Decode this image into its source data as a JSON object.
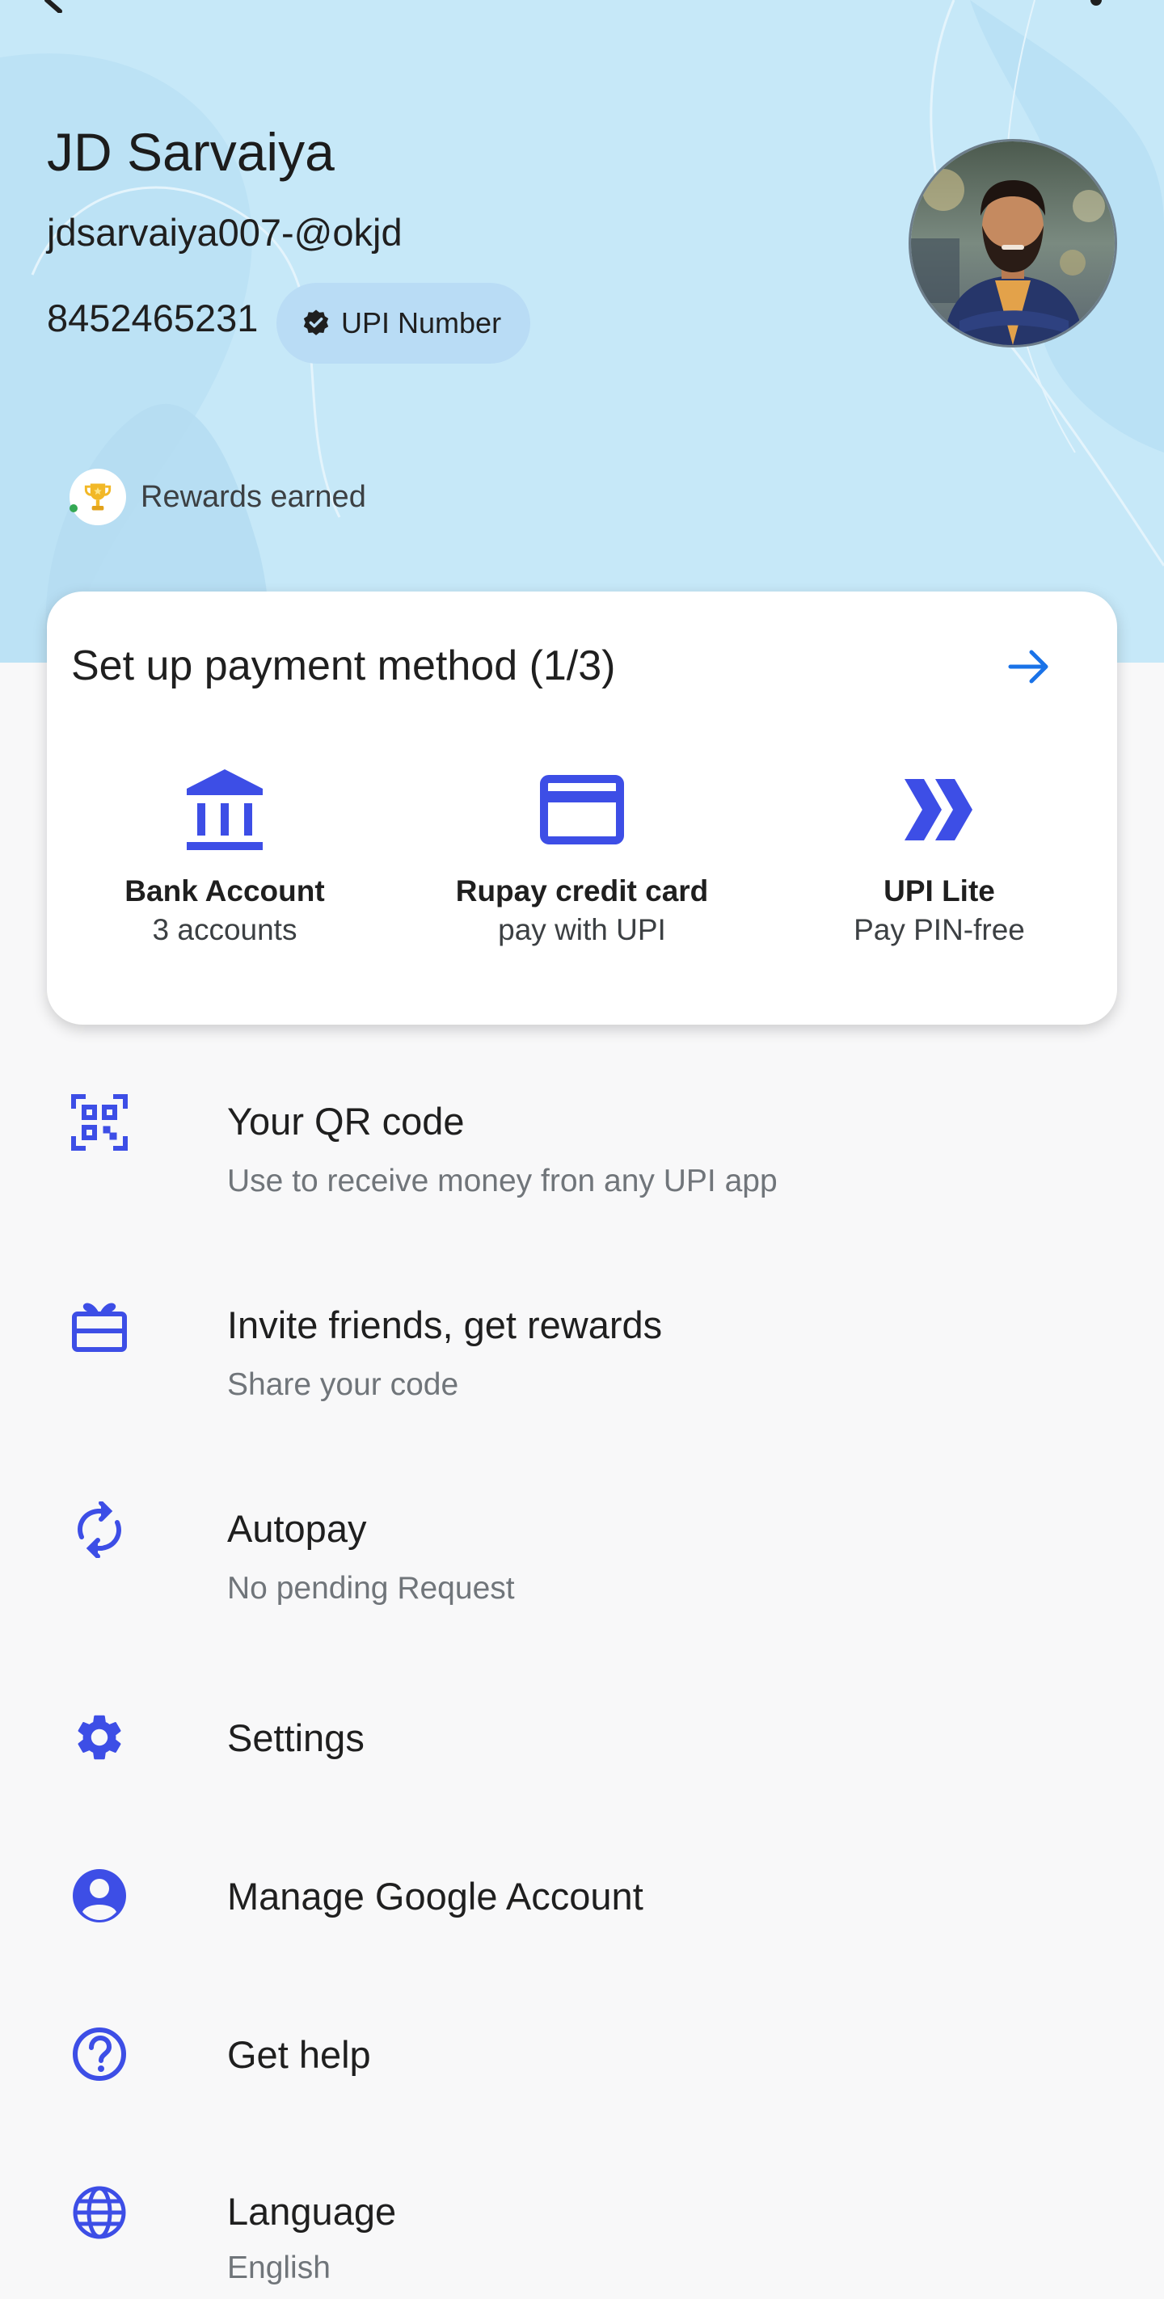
{
  "profile": {
    "name": "JD Sarvaiya",
    "upi_id": "jdsarvaiya007-@okjd",
    "phone": "8452465231",
    "upi_badge": "UPI Number",
    "rewards_label": "Rewards earned"
  },
  "payment_setup": {
    "title": "Set up payment method (1/3)",
    "methods": [
      {
        "title": "Bank Account",
        "subtitle": "3 accounts",
        "icon": "bank-icon"
      },
      {
        "title": "Rupay credit card",
        "subtitle": "pay with UPI",
        "icon": "credit-card-icon"
      },
      {
        "title": "UPI Lite",
        "subtitle": "Pay PIN-free",
        "icon": "double-chevron-icon"
      }
    ]
  },
  "menu": [
    {
      "title": "Your QR code",
      "subtitle": "Use to receive money fron any UPI app",
      "icon": "qr-code-icon"
    },
    {
      "title": "Invite friends, get rewards",
      "subtitle": "Share your code",
      "icon": "gift-icon"
    },
    {
      "title": "Autopay",
      "subtitle": "No pending Request",
      "icon": "autopay-icon"
    },
    {
      "title": "Settings",
      "icon": "gear-icon"
    },
    {
      "title": "Manage Google Account",
      "icon": "account-icon"
    },
    {
      "title": "Get help",
      "icon": "help-icon"
    },
    {
      "title": "Language",
      "subtitle": "English",
      "icon": "globe-icon"
    }
  ],
  "colors": {
    "accent": "#3d4ee6",
    "header_bg": "#c6e8f8",
    "arrow": "#1a73e8",
    "page_bg": "#f8f8f9"
  }
}
